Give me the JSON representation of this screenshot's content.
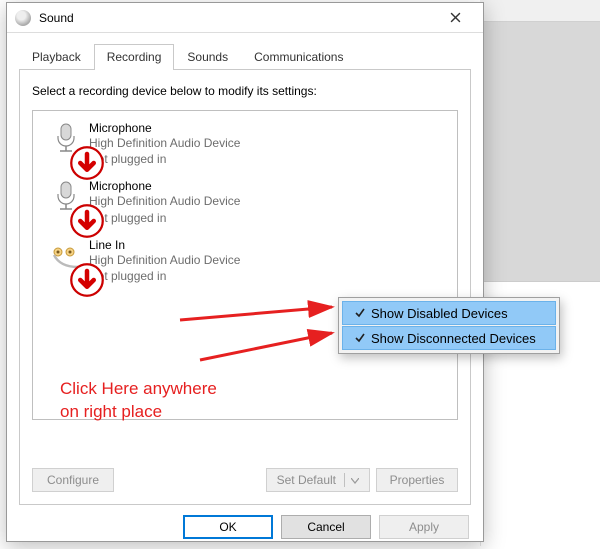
{
  "window": {
    "title": "Sound",
    "close_label": "Close"
  },
  "tabs": {
    "playback": "Playback",
    "recording": "Recording",
    "sounds": "Sounds",
    "communications": "Communications",
    "active": "recording"
  },
  "instruction": "Select a recording device below to modify its settings:",
  "devices": [
    {
      "name": "Microphone",
      "sub1": "High Definition Audio Device",
      "sub2": "Not plugged in",
      "icon": "mic"
    },
    {
      "name": "Microphone",
      "sub1": "High Definition Audio Device",
      "sub2": "Not plugged in",
      "icon": "mic"
    },
    {
      "name": "Line In",
      "sub1": "High Definition Audio Device",
      "sub2": "Not plugged in",
      "icon": "linein"
    }
  ],
  "tab_buttons": {
    "configure": "Configure",
    "set_default": "Set Default",
    "properties": "Properties"
  },
  "footer": {
    "ok": "OK",
    "cancel": "Cancel",
    "apply": "Apply"
  },
  "context_menu": {
    "show_disabled": "Show Disabled Devices",
    "show_disconnected": "Show Disconnected Devices"
  },
  "hint": {
    "line1": "Click Here anywhere",
    "line2": "on right place"
  }
}
